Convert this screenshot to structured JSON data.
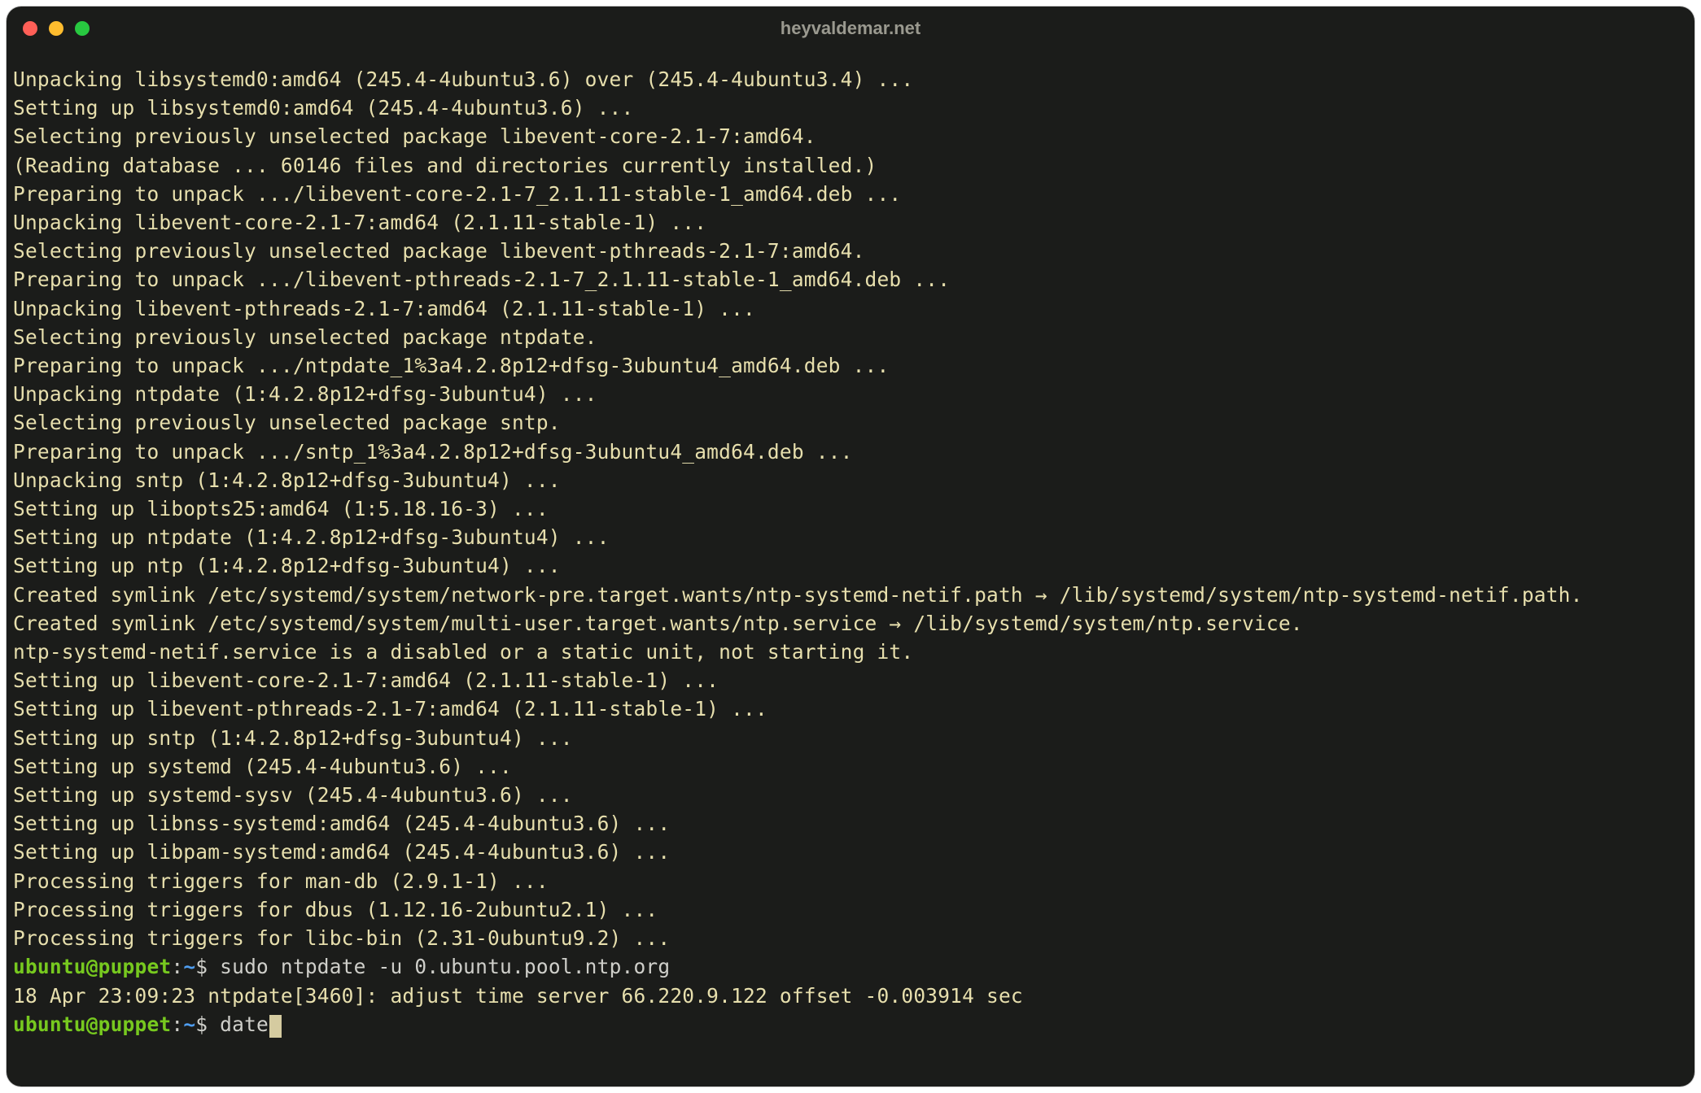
{
  "window": {
    "title": "heyvaldemar.net"
  },
  "terminal": {
    "lines": [
      "Unpacking libsystemd0:amd64 (245.4-4ubuntu3.6) over (245.4-4ubuntu3.4) ...",
      "Setting up libsystemd0:amd64 (245.4-4ubuntu3.6) ...",
      "Selecting previously unselected package libevent-core-2.1-7:amd64.",
      "(Reading database ... 60146 files and directories currently installed.)",
      "Preparing to unpack .../libevent-core-2.1-7_2.1.11-stable-1_amd64.deb ...",
      "Unpacking libevent-core-2.1-7:amd64 (2.1.11-stable-1) ...",
      "Selecting previously unselected package libevent-pthreads-2.1-7:amd64.",
      "Preparing to unpack .../libevent-pthreads-2.1-7_2.1.11-stable-1_amd64.deb ...",
      "Unpacking libevent-pthreads-2.1-7:amd64 (2.1.11-stable-1) ...",
      "Selecting previously unselected package ntpdate.",
      "Preparing to unpack .../ntpdate_1%3a4.2.8p12+dfsg-3ubuntu4_amd64.deb ...",
      "Unpacking ntpdate (1:4.2.8p12+dfsg-3ubuntu4) ...",
      "Selecting previously unselected package sntp.",
      "Preparing to unpack .../sntp_1%3a4.2.8p12+dfsg-3ubuntu4_amd64.deb ...",
      "Unpacking sntp (1:4.2.8p12+dfsg-3ubuntu4) ...",
      "Setting up libopts25:amd64 (1:5.18.16-3) ...",
      "Setting up ntpdate (1:4.2.8p12+dfsg-3ubuntu4) ...",
      "Setting up ntp (1:4.2.8p12+dfsg-3ubuntu4) ...",
      "Created symlink /etc/systemd/system/network-pre.target.wants/ntp-systemd-netif.path → /lib/systemd/system/ntp-systemd-netif.path.",
      "Created symlink /etc/systemd/system/multi-user.target.wants/ntp.service → /lib/systemd/system/ntp.service.",
      "ntp-systemd-netif.service is a disabled or a static unit, not starting it.",
      "Setting up libevent-core-2.1-7:amd64 (2.1.11-stable-1) ...",
      "Setting up libevent-pthreads-2.1-7:amd64 (2.1.11-stable-1) ...",
      "Setting up sntp (1:4.2.8p12+dfsg-3ubuntu4) ...",
      "Setting up systemd (245.4-4ubuntu3.6) ...",
      "Setting up systemd-sysv (245.4-4ubuntu3.6) ...",
      "Setting up libnss-systemd:amd64 (245.4-4ubuntu3.6) ...",
      "Setting up libpam-systemd:amd64 (245.4-4ubuntu3.6) ...",
      "Processing triggers for man-db (2.9.1-1) ...",
      "Processing triggers for dbus (1.12.16-2ubuntu2.1) ...",
      "Processing triggers for libc-bin (2.31-0ubuntu9.2) ..."
    ],
    "prompts": [
      {
        "userhost": "ubuntu@puppet",
        "sep": ":",
        "path": "~",
        "dollar": "$ ",
        "cmd": "sudo ntpdate -u 0.ubuntu.pool.ntp.org",
        "output": "18 Apr 23:09:23 ntpdate[3460]: adjust time server 66.220.9.122 offset -0.003914 sec"
      },
      {
        "userhost": "ubuntu@puppet",
        "sep": ":",
        "path": "~",
        "dollar": "$ ",
        "cmd": "date",
        "cursor": true
      }
    ]
  }
}
